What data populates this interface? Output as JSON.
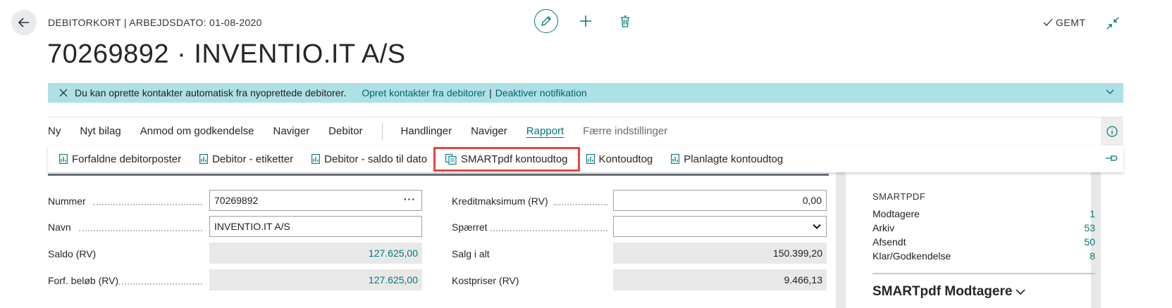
{
  "header": {
    "caption": "DEBITORKORT | ARBEJDSDATO: 01-08-2020",
    "title": "70269892 · INVENTIO.IT A/S",
    "saved_label": "GEMT"
  },
  "notification": {
    "message": "Du kan oprette kontakter automatisk fra nyoprettede debitorer.",
    "link1": "Opret kontakter fra debitorer",
    "separator": "|",
    "link2": "Deaktiver notifikation"
  },
  "menu": {
    "items": [
      "Ny",
      "Nyt bilag",
      "Anmod om godkendelse",
      "Naviger",
      "Debitor"
    ],
    "items2": [
      "Handlinger",
      "Naviger"
    ],
    "active": "Rapport",
    "fewer": "Færre indstillinger"
  },
  "reports": {
    "items": [
      "Forfaldne debitorposter",
      "Debitor - etiketter",
      "Debitor - saldo til dato",
      "SMARTpdf kontoudtog",
      "Kontoudtog",
      "Planlagte kontoudtog"
    ]
  },
  "form": {
    "left": [
      {
        "label": "Nummer",
        "value": "70269892"
      },
      {
        "label": "Navn",
        "value": "INVENTIO.IT A/S"
      },
      {
        "label": "Saldo (RV)",
        "value": "127.625,00"
      },
      {
        "label": "Forf. beløb (RV)",
        "value": "127.625,00"
      }
    ],
    "right": [
      {
        "label": "Kreditmaksimum (RV)",
        "value": "0,00"
      },
      {
        "label": "Spærret",
        "value": ""
      },
      {
        "label": "Salg i alt",
        "value": "150.399,20"
      },
      {
        "label": "Kostpriser (RV)",
        "value": "9.466,13"
      }
    ]
  },
  "side": {
    "title": "SMARTPDF",
    "cues": [
      {
        "label": "Modtagere",
        "value": "1"
      },
      {
        "label": "Arkiv",
        "value": "53"
      },
      {
        "label": "Afsendt",
        "value": "50"
      },
      {
        "label": "Klar/Godkendelse",
        "value": "8"
      }
    ],
    "subtitle": "SMARTpdf Modtagere"
  },
  "colors": {
    "accent": "#00787a",
    "notification_bg": "#ade1e6",
    "highlight": "#e5473d"
  }
}
